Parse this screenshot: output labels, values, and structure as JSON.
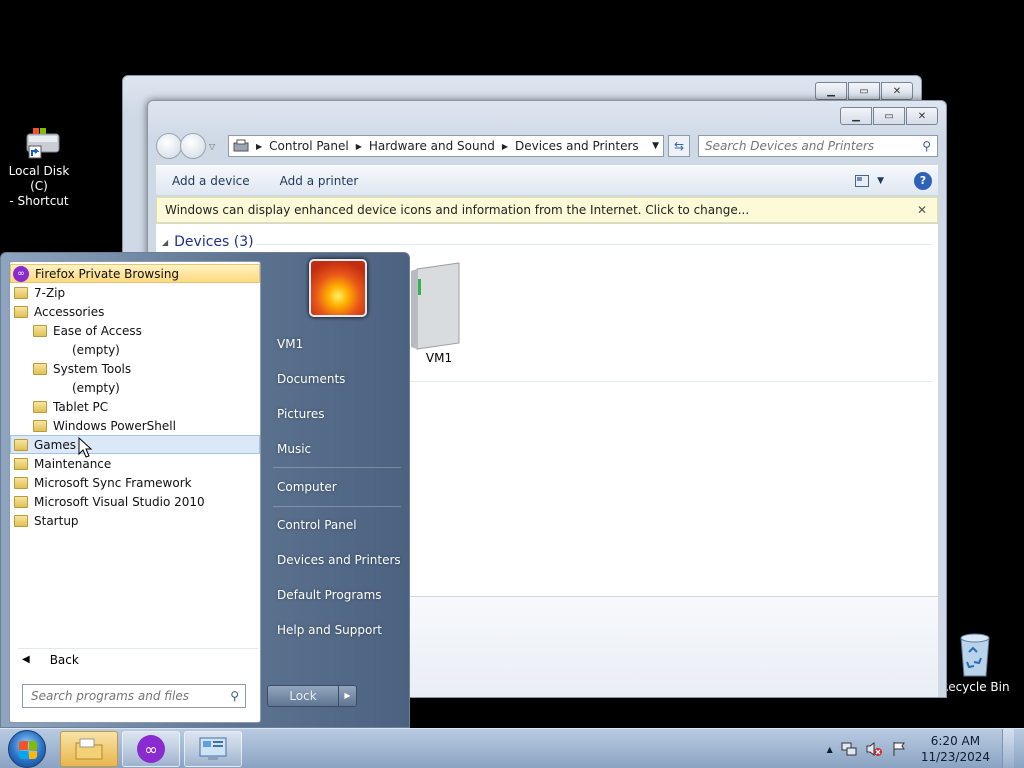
{
  "desktop": {
    "icons": {
      "local_disk": "Local Disk (C)\n- Shortcut",
      "recycle_bin": "Recycle Bin"
    }
  },
  "explorer": {
    "breadcrumbs": [
      "Control Panel",
      "Hardware and Sound",
      "Devices and Printers"
    ],
    "search_placeholder": "Search Devices and Printers",
    "commands": {
      "add_device": "Add a device",
      "add_printer": "Add a printer"
    },
    "infobar": "Windows can display enhanced device icons and information from the Internet. Click to change...",
    "group_title": "Devices (3)",
    "device_label": "VM1"
  },
  "start_menu": {
    "programs": [
      {
        "label": "Firefox Private Browsing",
        "type": "app"
      },
      {
        "label": "7-Zip",
        "type": "folder"
      },
      {
        "label": "Accessories",
        "type": "folder"
      },
      {
        "label": "Ease of Access",
        "type": "folder"
      },
      {
        "label": "(empty)",
        "type": "empty"
      },
      {
        "label": "System Tools",
        "type": "folder"
      },
      {
        "label": "(empty)",
        "type": "empty"
      },
      {
        "label": "Tablet PC",
        "type": "folder"
      },
      {
        "label": "Windows PowerShell",
        "type": "folder"
      },
      {
        "label": "Games",
        "type": "folder"
      },
      {
        "label": "Maintenance",
        "type": "folder"
      },
      {
        "label": "Microsoft Sync Framework",
        "type": "folder"
      },
      {
        "label": "Microsoft Visual Studio 2010",
        "type": "folder"
      },
      {
        "label": "Startup",
        "type": "folder"
      }
    ],
    "back": "Back",
    "search_placeholder": "Search programs and files",
    "right_items": [
      "VM1",
      "Documents",
      "Pictures",
      "Music",
      "Computer",
      "Control Panel",
      "Devices and Printers",
      "Default Programs",
      "Help and Support"
    ],
    "lock": "Lock"
  },
  "taskbar": {
    "time": "6:20 AM",
    "date": "11/23/2024"
  }
}
